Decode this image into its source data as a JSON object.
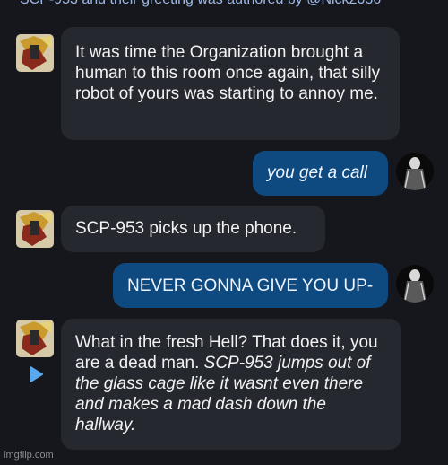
{
  "header": {
    "text": "SCP-953 and their greeting was authored by @Nick2036"
  },
  "messages": [
    {
      "sender": "bot",
      "text": "It was time the Organization brought a human to this room once again, that silly robot of yours was starting to annoy me."
    },
    {
      "sender": "user",
      "text": "you get a call"
    },
    {
      "sender": "bot",
      "text": "SCP-953 picks up the phone."
    },
    {
      "sender": "user",
      "text": "NEVER GONNA GIVE YOU UP-"
    },
    {
      "sender": "bot",
      "text_plain": "What in the fresh Hell? That does it, you are a dead man.",
      "text_action": "SCP-953 jumps out of the glass cage like it wasnt even there and makes a mad dash down the hallway."
    }
  ],
  "icons": {
    "bot_avatar": "bot-avatar-image",
    "user_avatar": "user-avatar-image",
    "regenerate": "play-icon"
  },
  "colors": {
    "background": "#16171c",
    "bot_bubble": "#262830",
    "user_bubble": "#0e4a7f",
    "header_text": "#9db8e6"
  },
  "watermark": "imgflip.com"
}
